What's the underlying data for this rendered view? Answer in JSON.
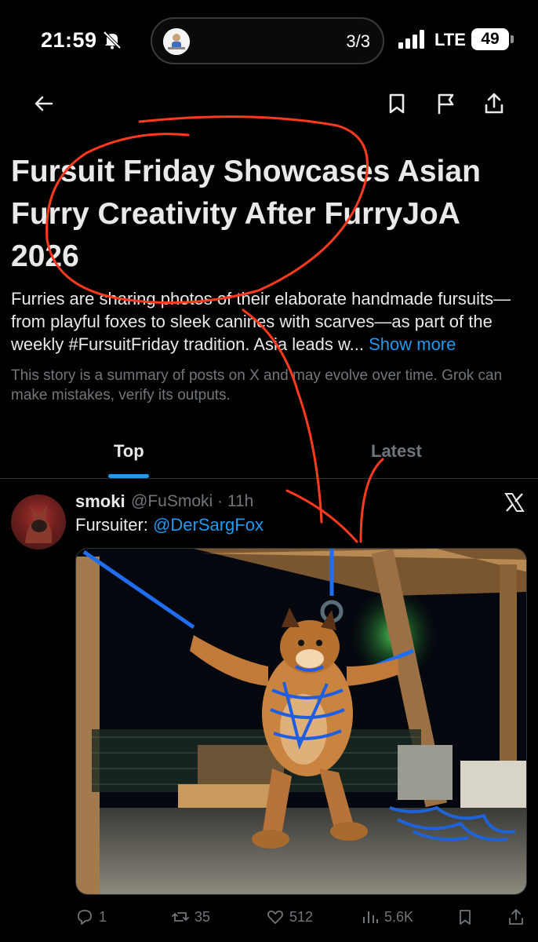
{
  "status_bar": {
    "time": "21:59",
    "pill_counter": "3/3",
    "network": "LTE",
    "battery": "49"
  },
  "toolbar": {
    "back": "back-arrow-icon",
    "bookmark": "bookmark-icon",
    "report": "flag-icon",
    "share": "share-icon"
  },
  "article": {
    "headline": "Fursuit Friday Showcases Asian Furry Creativity After FurryJoA 2026",
    "summary": "Furries are sharing photos of their elaborate handmade fursuits—from playful foxes to sleek canines with scarves—as part of the weekly #FursuitFriday tradition. Asia leads w...",
    "show_more": "Show more",
    "disclaimer": "This story is a summary of posts on X and may evolve over time. Grok can make mistakes, verify its outputs."
  },
  "tabs": [
    {
      "label": "Top",
      "active": true
    },
    {
      "label": "Latest",
      "active": false
    }
  ],
  "post": {
    "name": "smoki",
    "handle": "@FuSmoki · 11h",
    "text_prefix": "Fursuiter: ",
    "mention": "@DerSargFox",
    "actions": {
      "replies": "1",
      "reposts": "35",
      "likes": "512",
      "views": "5.6K"
    }
  },
  "colors": {
    "background": "#000000",
    "text": "#e7e9ea",
    "muted": "#71767b",
    "accent": "#1d9bf0",
    "annotation": "#ff3b1f"
  }
}
